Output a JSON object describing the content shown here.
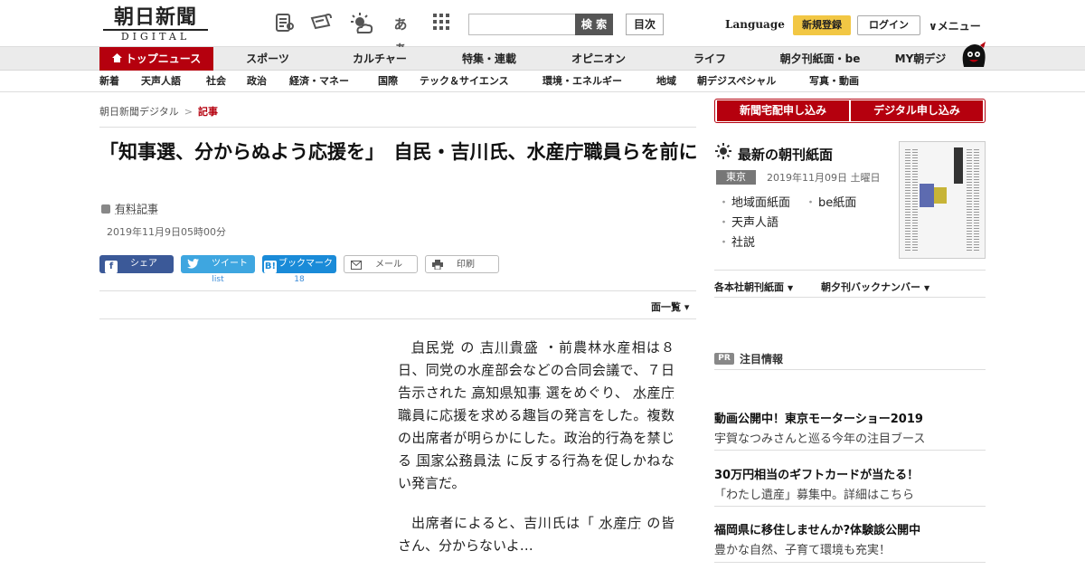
{
  "header": {
    "logo_ja": "朝日新聞",
    "logo_en": "DIGITAL",
    "icons": [
      "list-icon",
      "megaphone-icon",
      "weather-icon",
      "font-size-icon",
      "grid-icon"
    ],
    "font_icon_text": "あぁ",
    "search_placeholder": "",
    "search_label": "検 索",
    "mokuji_label": "目次",
    "language_label": "Language",
    "register_label": "新規登録",
    "login_label": "ログイン",
    "menu_label": "∨メニュー"
  },
  "nav1": {
    "items": [
      {
        "label": "トップニュース"
      },
      {
        "label": "スポーツ"
      },
      {
        "label": "カルチャー"
      },
      {
        "label": "特集・連載"
      },
      {
        "label": "オピニオン"
      },
      {
        "label": "ライフ"
      },
      {
        "label": "朝夕刊紙面・be"
      },
      {
        "label": "MY朝デジ"
      }
    ]
  },
  "nav2": {
    "items": [
      {
        "label": "新着"
      },
      {
        "label": "天声人語"
      },
      {
        "label": "社会"
      },
      {
        "label": "政治"
      },
      {
        "label": "経済・マネー"
      },
      {
        "label": "国際"
      },
      {
        "label": "テック＆サイエンス"
      },
      {
        "label": "環境・エネルギー"
      },
      {
        "label": "地域"
      },
      {
        "label": "朝デジスペシャル"
      },
      {
        "label": "写真・動画"
      }
    ]
  },
  "breadcrumb": {
    "home": "朝日新聞デジタル",
    "sep": ">",
    "current": "記事"
  },
  "article": {
    "title": "「知事選、分からぬよう応援を」　自民・吉川氏、水産庁職員らを前に",
    "paid_label": "有料記事",
    "date": "2019年11月9日05時00分",
    "share": {
      "facebook": "シェア",
      "twitter": "ツイート",
      "hatena_icon": "B!",
      "hatena": "ブックマーク",
      "mail": "メール",
      "print": "印刷",
      "twitter_count": "list",
      "hatena_count": "18"
    },
    "menlist": "面一覧 ▾",
    "p1": {
      "k1": "自民党",
      "t1": " の ",
      "k2": "吉川貴盛",
      "t2": " ・前農林水産相は８日、同党の水産部会などの合同会議で、７日告示された ",
      "k3": "高知県知事",
      "t3": " 選をめぐり、 ",
      "k4": "水産庁",
      "t4": " 職員に応援を求める趣旨の発言をした。複数の出席者が明らかにした。政治的行為を禁じる ",
      "k5": "国家公務員法",
      "t5": " に反する行為を促しかねない発言だ。"
    },
    "p2": {
      "t1": "出席者によると、吉川氏は「 ",
      "k1": "水産庁",
      "t2": " の皆さん、分からないよ…"
    }
  },
  "sidebar": {
    "btn_delivery": "新聞宅配申し込み",
    "btn_digital": "デジタル申し込み",
    "paper_title": "最新の朝刊紙面",
    "region": "東京",
    "paper_date": "2019年11月09日 土曜日",
    "links": [
      "地域面紙面",
      "be紙面",
      "天声人語",
      "社説"
    ],
    "sub_links": [
      "各本社朝刊紙面",
      "朝夕刊バックナンバー"
    ],
    "pr_tag": "PR",
    "pr_title": "注目情報",
    "ads": [
      {
        "title": "動画公開中！東京モーターショー2019",
        "sub": "宇賀なつみさんと巡る今年の注目ブース"
      },
      {
        "title": "30万円相当のギフトカードが当たる！",
        "sub": "「わたし遺産」募集中。詳細はこちら"
      },
      {
        "title": "福岡県に移住しませんか?体験談公開中",
        "sub": "豊かな自然、子育て環境も充実！"
      }
    ]
  },
  "colors": {
    "brand_red": "#b5000e",
    "register_yellow": "#f2c744",
    "facebook": "#3b5998",
    "twitter": "#3ea6e0",
    "hatena": "#1a8bd8"
  }
}
